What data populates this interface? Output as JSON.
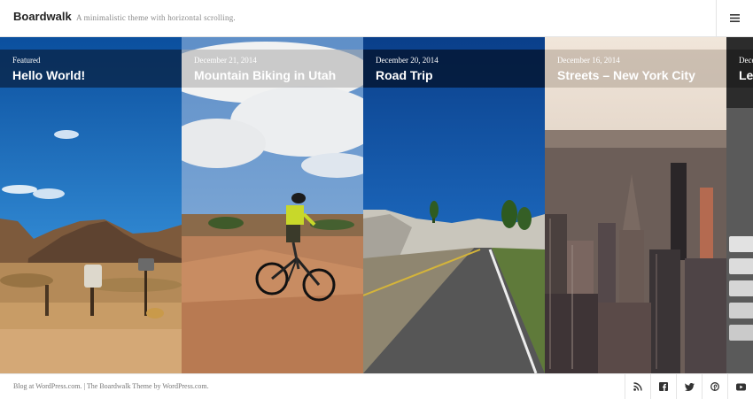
{
  "site": {
    "title": "Boardwalk",
    "description": "A minimalistic theme with horizontal scrolling."
  },
  "header": {
    "menu_icon": "hamburger-menu-icon"
  },
  "posts": [
    {
      "meta": "Featured",
      "title": "Hello World!"
    },
    {
      "meta": "December 21, 2014",
      "title": "Mountain Biking in Utah"
    },
    {
      "meta": "December 20, 2014",
      "title": "Road Trip"
    },
    {
      "meta": "December 16, 2014",
      "title": "Streets – New York City"
    },
    {
      "meta": "Dece",
      "title": "Lea"
    }
  ],
  "footer": {
    "blog_link": "Blog at WordPress.com.",
    "separator": " | ",
    "theme_link": "The Boardwalk Theme by WordPress.com.",
    "social_icons": [
      "rss-icon",
      "facebook-icon",
      "twitter-icon",
      "pinterest-icon",
      "youtube-icon"
    ]
  }
}
